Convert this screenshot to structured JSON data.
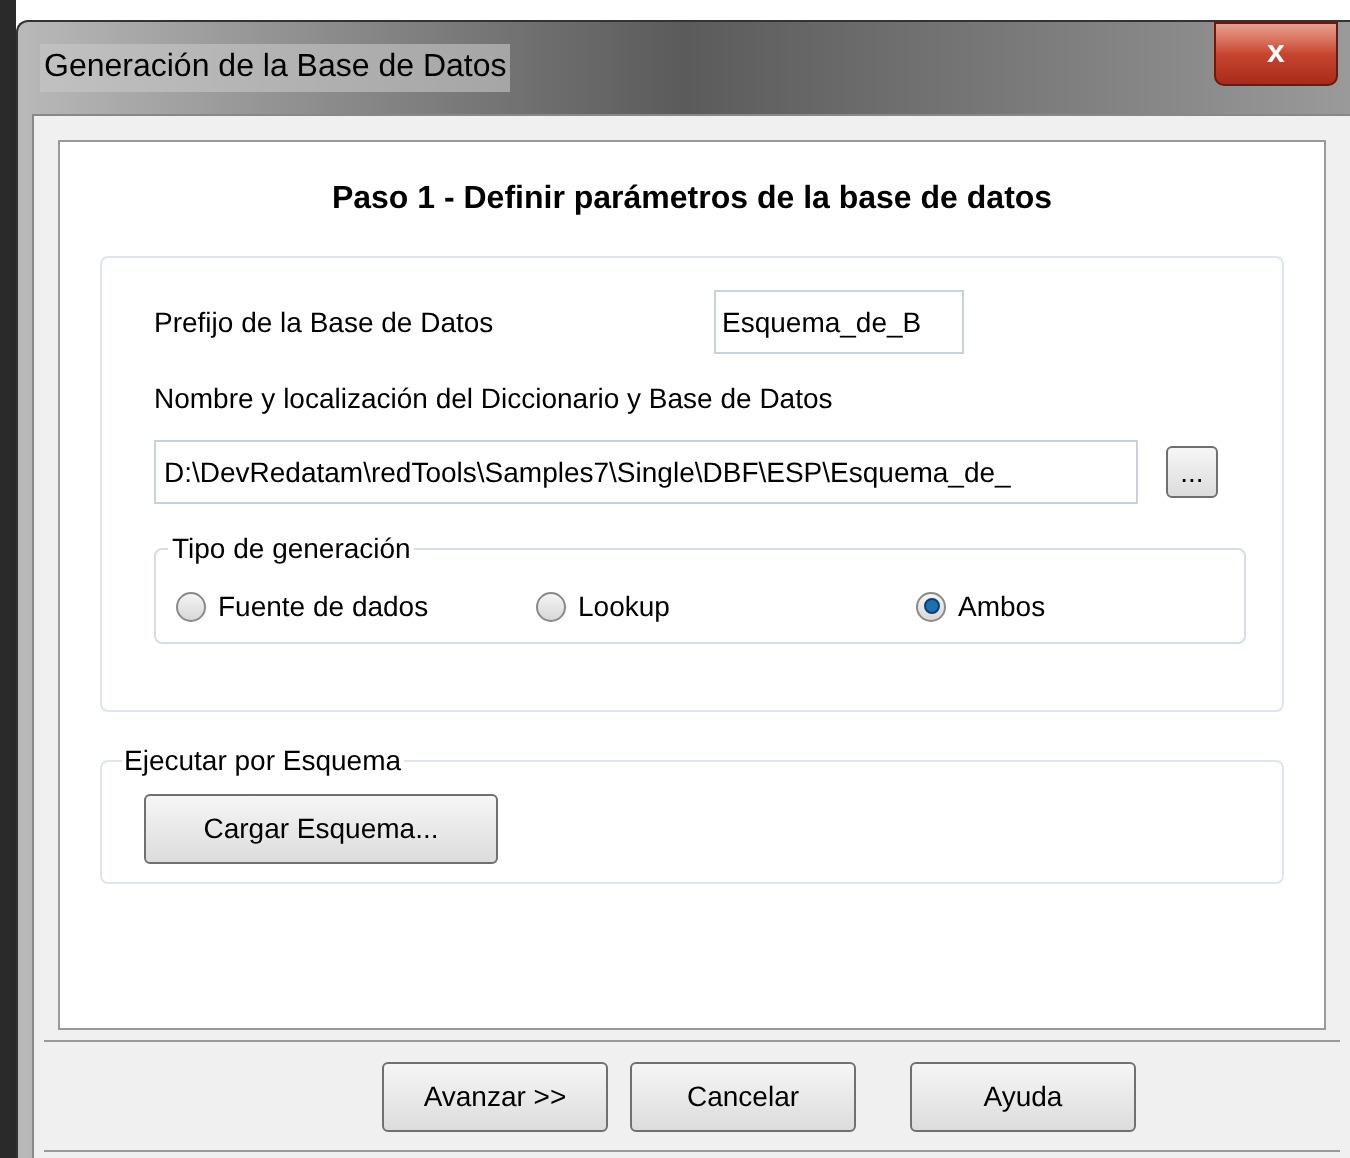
{
  "window": {
    "title": "Generación de la Base de Datos",
    "close": "x"
  },
  "heading": "Paso 1 - Definir parámetros de la base de datos",
  "prefix": {
    "label": "Prefijo de la Base de Datos",
    "value": "Esquema_de_B"
  },
  "location": {
    "label": "Nombre y localización del Diccionario y Base de Datos",
    "value": "D:\\DevRedatam\\redTools\\Samples7\\Single\\DBF\\ESP\\Esquema_de_",
    "browse": "..."
  },
  "generation_type": {
    "label": "Tipo de generación",
    "options": [
      {
        "label": "Fuente de dados",
        "selected": false
      },
      {
        "label": "Lookup",
        "selected": false
      },
      {
        "label": "Ambos",
        "selected": true
      }
    ]
  },
  "schema": {
    "label": "Ejecutar por Esquema",
    "button": "Cargar Esquema..."
  },
  "buttons": [
    "Avanzar >>",
    "Cancelar",
    "Ayuda"
  ]
}
